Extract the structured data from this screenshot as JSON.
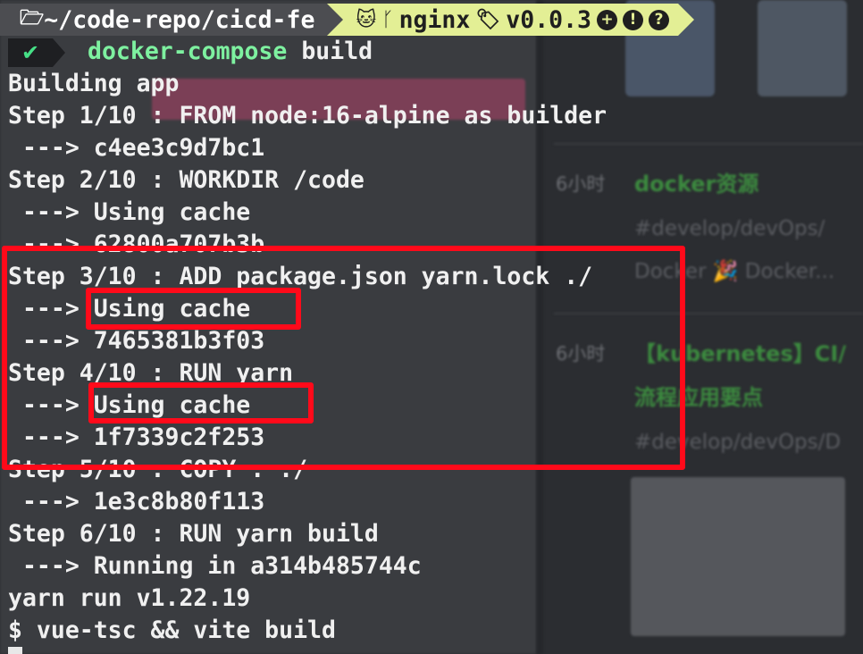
{
  "prompt": {
    "path": "~/code-repo/cicd-fe",
    "branch": "nginx",
    "tag": "v0.0.3",
    "status_icons": [
      "+",
      "!",
      "?"
    ]
  },
  "command": {
    "name": "docker-compose",
    "args": " build"
  },
  "output": [
    "Building app",
    "Step 1/10 : FROM node:16-alpine as builder",
    " ---> c4ee3c9d7bc1",
    "Step 2/10 : WORKDIR /code",
    " ---> Using cache",
    " ---> 62800a707b3b",
    "Step 3/10 : ADD package.json yarn.lock ./",
    " ---> Using cache",
    " ---> 7465381b3f03",
    "Step 4/10 : RUN yarn",
    " ---> Using cache",
    " ---> 1f7339c2f253",
    "Step 5/10 : COPY . ./",
    " ---> 1e3c8b80f113",
    "Step 6/10 : RUN yarn build",
    " ---> Running in a314b485744c",
    "yarn run v1.22.19",
    "$ vue-tsc && vite build"
  ],
  "background_notes": [
    {
      "time": "6小时",
      "title": "docker资源",
      "tag": "#develop/devOps/",
      "tag2": "Docker 🎉 Docker..."
    },
    {
      "time": "6小时",
      "title": "【kubernetes】CI/",
      "title2": "流程应用要点",
      "tag": "#develop/devOps/D"
    }
  ],
  "colors": {
    "highlight": "#ff0a1a",
    "command": "#7ef1a0",
    "prompt_path_bg": "#4c4d51",
    "prompt_git_bg": "#e3ef95"
  }
}
